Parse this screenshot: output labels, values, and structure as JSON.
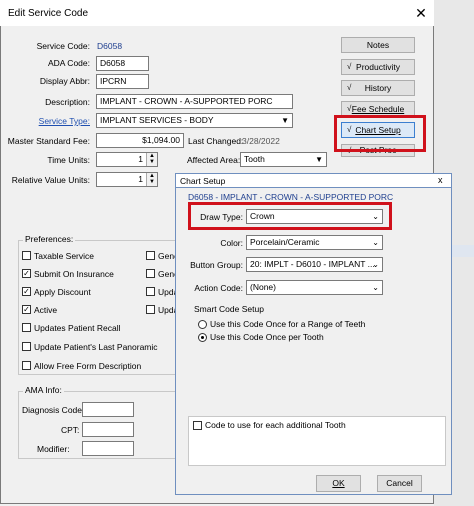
{
  "window": {
    "title": "Edit Service Code",
    "close_glyph": "✕"
  },
  "form": {
    "service_code_label": "Service Code:",
    "service_code": "D6058",
    "ada_code_label": "ADA Code:",
    "ada_code": "D6058",
    "display_abbr_label": "Display Abbr:",
    "display_abbr": "IPCRN",
    "description_label": "Description:",
    "description": "IMPLANT - CROWN - A-SUPPORTED PORC",
    "service_type_label": "Service Type:",
    "service_type": "IMPLANT SERVICES - BODY",
    "master_fee_label": "Master Standard Fee:",
    "master_fee": "$1,094.00",
    "last_changed_label": "Last Changed:",
    "last_changed": "3/28/2022",
    "time_units_label": "Time Units:",
    "time_units": "1",
    "affected_area_label": "Affected Area:",
    "affected_area": "Tooth",
    "rvu_label": "Relative Value Units:",
    "rvu": "1"
  },
  "right_buttons": [
    {
      "label": "Notes",
      "check": ""
    },
    {
      "label": "Productivity",
      "check": "√"
    },
    {
      "label": "History",
      "check": "√"
    },
    {
      "label": "Fee Schedule",
      "check": "√"
    },
    {
      "label": "Chart Setup",
      "check": "√"
    },
    {
      "label": "Post Proc",
      "check": "√"
    }
  ],
  "preferences": {
    "label": "Preferences:",
    "items": [
      {
        "label": "Taxable Service",
        "checked": ""
      },
      {
        "label": "Submit On Insurance",
        "checked": "✓"
      },
      {
        "label": "Apply Discount",
        "checked": "✓"
      },
      {
        "label": "Active",
        "checked": "✓"
      },
      {
        "label": "Updates Patient Recall",
        "checked": ""
      },
      {
        "label": "Update Patient's Last Panoramic",
        "checked": ""
      },
      {
        "label": "Allow Free Form Description",
        "checked": ""
      }
    ],
    "right_items": [
      "Gene",
      "Gene",
      "Upda",
      "Upda"
    ]
  },
  "ama": {
    "label": "AMA Info:",
    "diagnosis_label": "Diagnosis Code:",
    "cpt_label": "CPT:",
    "modifier_label": "Modifier:"
  },
  "chart_setup": {
    "title": "Chart Setup",
    "close_glyph": "x",
    "code_line": "D6058 - IMPLANT - CROWN - A-SUPPORTED PORC",
    "draw_type_label": "Draw Type:",
    "draw_type": "Crown",
    "color_label": "Color:",
    "color": "Porcelain/Ceramic",
    "button_group_label": "Button Group:",
    "button_group": "20: IMPLT - D6010 - IMPLANT ...",
    "action_code_label": "Action Code:",
    "action_code": "(None)",
    "smart_code_label": "Smart Code Setup",
    "radio_range": "Use this Code Once for a Range of Teeth",
    "radio_per_tooth": "Use this Code Once per Tooth",
    "additional_tooth_label": "Code to use for each additional Tooth",
    "ok_label": "OK",
    "cancel_label": "Cancel"
  }
}
